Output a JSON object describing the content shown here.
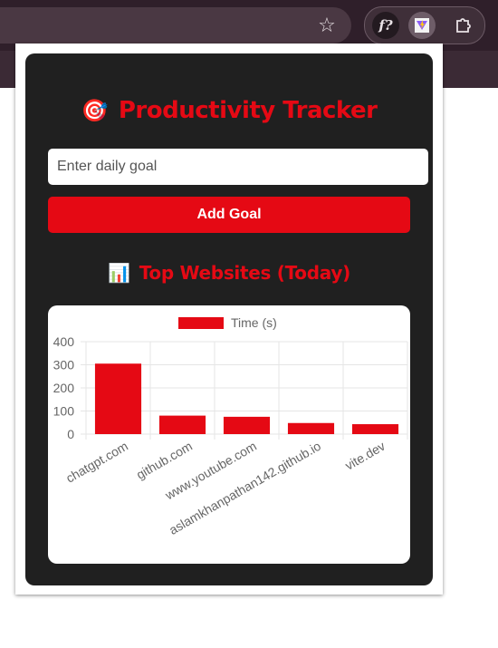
{
  "browser": {
    "extension_f_label": "f?",
    "star_icon": "star-icon",
    "puzzle_icon": "puzzle-icon"
  },
  "popup": {
    "title_emoji": "🎯",
    "title": "Productivity Tracker",
    "goal_placeholder": "Enter daily goal",
    "goal_value": "",
    "add_goal_label": "Add Goal",
    "section_emoji": "📊",
    "section_title": "Top Websites (Today)"
  },
  "colors": {
    "accent": "#e50914",
    "panel_bg": "#202020"
  },
  "chart_data": {
    "type": "bar",
    "legend": "Time (s)",
    "categories": [
      "chatgpt.com",
      "github.com",
      "www.youtube.com",
      "aslamkhanpathan142.github.io",
      "vite.dev"
    ],
    "values": [
      305,
      80,
      75,
      48,
      43
    ],
    "ylim": [
      0,
      400
    ],
    "yticks": [
      0,
      100,
      200,
      300,
      400
    ],
    "grid": true,
    "legend_position": "top"
  }
}
